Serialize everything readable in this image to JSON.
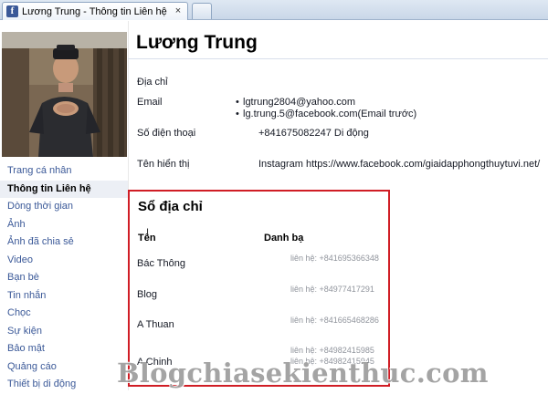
{
  "browser": {
    "tab_title": "Lương Trung - Thông tin Liên hệ",
    "favicon_letter": "f"
  },
  "profile": {
    "name": "Lương Trung"
  },
  "nav": {
    "items": [
      {
        "label": "Trang cá nhân",
        "active": false
      },
      {
        "label": "Thông tin Liên hệ",
        "active": true
      },
      {
        "label": "Dòng thời gian",
        "active": false
      },
      {
        "label": "Ảnh",
        "active": false
      },
      {
        "label": "Ảnh đã chia sẻ",
        "active": false
      },
      {
        "label": "Video",
        "active": false
      },
      {
        "label": "Bạn bè",
        "active": false
      },
      {
        "label": "Tin nhắn",
        "active": false
      },
      {
        "label": "Chọc",
        "active": false
      },
      {
        "label": "Sự kiện",
        "active": false
      },
      {
        "label": "Bảo mật",
        "active": false
      },
      {
        "label": "Quảng cáo",
        "active": false
      },
      {
        "label": "Thiết bị di động",
        "active": false
      }
    ]
  },
  "info": {
    "address_label": "Địa chỉ",
    "email_label": "Email",
    "emails": [
      "lgtrung2804@yahoo.com",
      "lg.trung.5@facebook.com(Email trước)"
    ],
    "phone_label": "Số điện thoại",
    "phone_value": "+841675082247 Di động",
    "display_name_label": "Tên hiển thị",
    "display_name_value": "Instagram https://www.facebook.com/giaidapphongthuytuvi.net/"
  },
  "address_book": {
    "title": "Sổ địa chỉ",
    "col_name": "Tên",
    "col_contacts": "Danh bạ",
    "contacts": [
      {
        "name": "Bác Thông",
        "phones": [
          "liên hệ: +841695366348"
        ]
      },
      {
        "name": "Blog",
        "phones": [
          "liên hệ: +84977417291"
        ]
      },
      {
        "name": "A Thuan",
        "phones": [
          "liên hệ: +841665468286"
        ]
      },
      {
        "name": "A Chinh",
        "phones": [
          "liên hệ: +84982415985",
          "liên hệ: +84982415945"
        ]
      }
    ]
  },
  "watermark": "Blogchiasekienthuc.com",
  "colors": {
    "link": "#3b5998",
    "highlight_box": "#d01d25",
    "muted": "#90949c"
  }
}
